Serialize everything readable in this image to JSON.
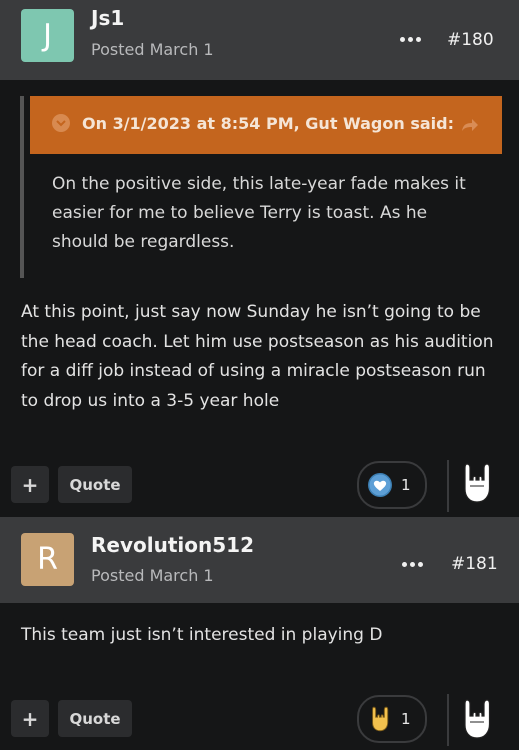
{
  "posts": [
    {
      "avatar_letter": "J",
      "avatar_color": "#7ec7b0",
      "author": "Js1",
      "posted": "Posted March 1",
      "post_number": "#180",
      "quote": {
        "title": "On 3/1/2023 at 8:54 PM, Gut Wagon said:",
        "text": "On the positive side, this late-year fade makes it easier for me to believe Terry is toast. As he should be regardless."
      },
      "body": "At this point, just say now Sunday he isn’t going to be the head coach. Let him use postseason as his audition for a diff job instead of using a miracle postseason run to drop us into a 3-5 year hole",
      "actions": {
        "plus_label": "+",
        "quote_label": "Quote"
      },
      "reaction": {
        "icon": "heart-icon",
        "count": "1"
      }
    },
    {
      "avatar_letter": "R",
      "avatar_color": "#c8a274",
      "author": "Revolution512",
      "posted": "Posted March 1",
      "post_number": "#181",
      "body": "This team just isn’t interested in playing D",
      "actions": {
        "plus_label": "+",
        "quote_label": "Quote"
      },
      "reaction": {
        "icon": "rock-hand-icon",
        "count": "1"
      }
    }
  ],
  "colors": {
    "accent_quote": "#c4651e",
    "header_bg": "#3a3b3d",
    "page_bg": "#151617"
  }
}
